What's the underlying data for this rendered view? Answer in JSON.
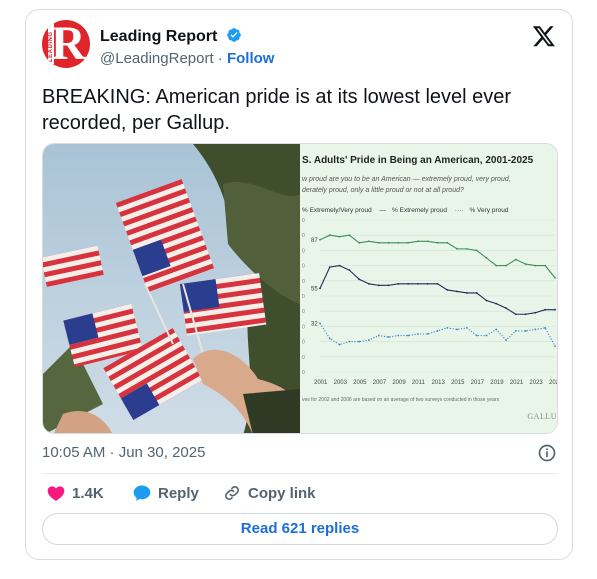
{
  "author": {
    "name": "Leading Report",
    "handle": "@LeadingReport",
    "separator": " · ",
    "follow_label": "Follow",
    "avatar_letter": "R",
    "avatar_text": "LEADING"
  },
  "tweet": {
    "text": "BREAKING: American pride is at its lowest level ever recorded, per Gallup.",
    "timestamp": "10:05 AM · Jun 30, 2025"
  },
  "media": {
    "chart_title": "S. Adults' Pride in Being an American, 2001-2025",
    "chart_subtitle": "w proud are you to be an American — extremely proud, very proud,\nderately proud, only a little proud or not at all proud?",
    "note": "ves for 2002 and 2006 are based on an average of two surveys conducted in those years",
    "source": "GALLU"
  },
  "chart_data": {
    "type": "line",
    "title": "S. Adults' Pride in Being an American, 2001-2025",
    "x": [
      2001,
      2002,
      2003,
      2004,
      2005,
      2006,
      2007,
      2008,
      2009,
      2010,
      2011,
      2012,
      2013,
      2014,
      2015,
      2016,
      2017,
      2018,
      2019,
      2020,
      2021,
      2022,
      2023,
      2024,
      2025
    ],
    "x_ticks": [
      "2001",
      "2003",
      "2005",
      "2007",
      "2009",
      "2011",
      "2013",
      "2015",
      "2017",
      "2019",
      "2021",
      "2023",
      "202"
    ],
    "series": [
      {
        "name": "% Extremely/Very proud",
        "color": "#3d8f5a",
        "style": "solid",
        "values": [
          87,
          90,
          89,
          90,
          85,
          86,
          85,
          85,
          85,
          85,
          86,
          86,
          85,
          85,
          81,
          81,
          80,
          75,
          70,
          70,
          74,
          71,
          70,
          70,
          62
        ]
      },
      {
        "name": "% Extremely proud",
        "color": "#1f2a5c",
        "style": "solid",
        "values": [
          55,
          69,
          70,
          67,
          61,
          58,
          57,
          57,
          58,
          58,
          58,
          58,
          58,
          54,
          53,
          52,
          52,
          47,
          45,
          42,
          38,
          38,
          39,
          41,
          41
        ]
      },
      {
        "name": "% Very proud",
        "color": "#3a89c9",
        "style": "dotted",
        "values": [
          32,
          22,
          18,
          20,
          20,
          21,
          24,
          23,
          24,
          24,
          25,
          25,
          27,
          29,
          28,
          29,
          24,
          24,
          28,
          21,
          27,
          27,
          28,
          29,
          17
        ]
      }
    ],
    "value_labels": [
      "87",
      "55",
      "32"
    ],
    "ylim": [
      0,
      100
    ],
    "grid": true,
    "legend": "top-left"
  },
  "engagement": {
    "likes": "1.4K",
    "reply_label": "Reply",
    "copy_label": "Copy link",
    "read_replies": "Read 621 replies"
  },
  "colors": {
    "accent": "#1d6fd3",
    "verified": "#1d9bf0",
    "like": "#f91880",
    "avatar_bg": "#e0242b"
  }
}
